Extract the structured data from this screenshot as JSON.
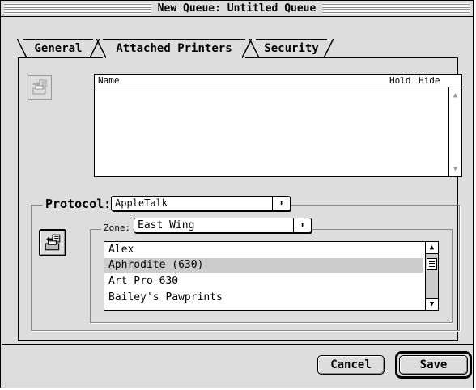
{
  "window": {
    "title": "New Queue: Untitled Queue"
  },
  "tabs": [
    {
      "label": "General",
      "active": false
    },
    {
      "label": "Attached Printers",
      "active": true
    },
    {
      "label": "Security",
      "active": false
    }
  ],
  "attached_list": {
    "columns": [
      "Name",
      "Hold",
      "Hide"
    ],
    "rows": []
  },
  "protocol": {
    "label": "Protocol:",
    "value": "AppleTalk",
    "arrows": "⬍"
  },
  "zone": {
    "label": "Zone:",
    "value": "East Wing",
    "arrows": "⬍"
  },
  "printers": {
    "items": [
      "Alex",
      "Aphrodite (630)",
      "Art Pro 630",
      "Bailey's Pawprints"
    ],
    "selected_index": 1
  },
  "buttons": {
    "cancel": "Cancel",
    "save": "Save"
  },
  "icons": {
    "add_printer": "printer-add-icon",
    "attached_printer": "printer-list-icon"
  }
}
